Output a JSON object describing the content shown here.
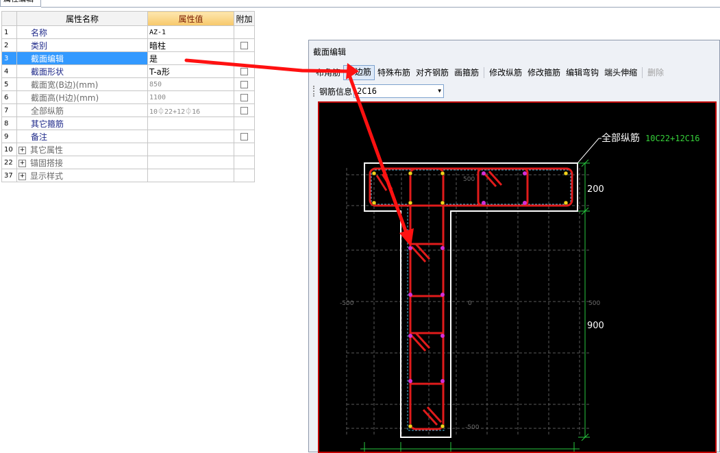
{
  "tab": {
    "label": "属性编辑"
  },
  "grid": {
    "headers": {
      "name": "属性名称",
      "value": "属性值",
      "add": "附加"
    },
    "rows": [
      {
        "num": "1",
        "name": "名称",
        "value": "AZ-1",
        "style": "blue",
        "has_check": false
      },
      {
        "num": "2",
        "name": "类别",
        "value": "暗柱",
        "style": "blue",
        "has_check": true
      },
      {
        "num": "3",
        "name": "截面编辑",
        "value": "是",
        "style": "selected",
        "has_check": false
      },
      {
        "num": "4",
        "name": "截面形状",
        "value": "T-a形",
        "style": "blue",
        "has_check": true
      },
      {
        "num": "5",
        "name": "截面宽(B边)(mm)",
        "value": "850",
        "style": "gray",
        "has_check": true
      },
      {
        "num": "6",
        "name": "截面高(H边)(mm)",
        "value": "1100",
        "style": "gray",
        "has_check": true
      },
      {
        "num": "7",
        "name": "全部纵筋",
        "value": "10⏀22+12⏀16",
        "style": "gray",
        "has_check": true
      },
      {
        "num": "8",
        "name": "其它箍筋",
        "value": "",
        "style": "blue",
        "has_check": false
      },
      {
        "num": "9",
        "name": "备注",
        "value": "",
        "style": "blue",
        "has_check": true
      },
      {
        "num": "10",
        "name": "其它属性",
        "value": "",
        "style": "group",
        "has_check": false
      },
      {
        "num": "22",
        "name": "锚固搭接",
        "value": "",
        "style": "group",
        "has_check": false
      },
      {
        "num": "37",
        "name": "显示样式",
        "value": "",
        "style": "group",
        "has_check": false
      }
    ]
  },
  "editor": {
    "title": "截面编辑",
    "toolbar": [
      {
        "label": "布角筋",
        "state": "normal"
      },
      {
        "label": "布边筋",
        "state": "pressed"
      },
      {
        "label": "特殊布筋",
        "state": "normal"
      },
      {
        "label": "对齐钢筋",
        "state": "normal"
      },
      {
        "label": "画箍筋",
        "state": "normal"
      },
      {
        "label": "修改纵筋",
        "state": "normal"
      },
      {
        "label": "修改箍筋",
        "state": "normal"
      },
      {
        "label": "编辑弯钩",
        "state": "normal"
      },
      {
        "label": "端头伸缩",
        "state": "normal"
      },
      {
        "label": "删除",
        "state": "disabled"
      }
    ],
    "rebar_label": "钢筋信息",
    "rebar_value": "2C16",
    "drawing": {
      "leader_label": "全部纵筋",
      "leader_value": "10C22+12C16",
      "dim_flange": "200",
      "dim_web": "900",
      "grid_label_top": "500",
      "grid_label_left": "-500",
      "grid_label_center": "0",
      "grid_label_right": "500",
      "grid_label_bottom": "-500"
    },
    "colors": {
      "rebar": "#e11b1b",
      "dimension": "#27c93f",
      "outline": "#ffffff",
      "leader_value": "#36d13a",
      "arrow": "#ff1111"
    }
  }
}
